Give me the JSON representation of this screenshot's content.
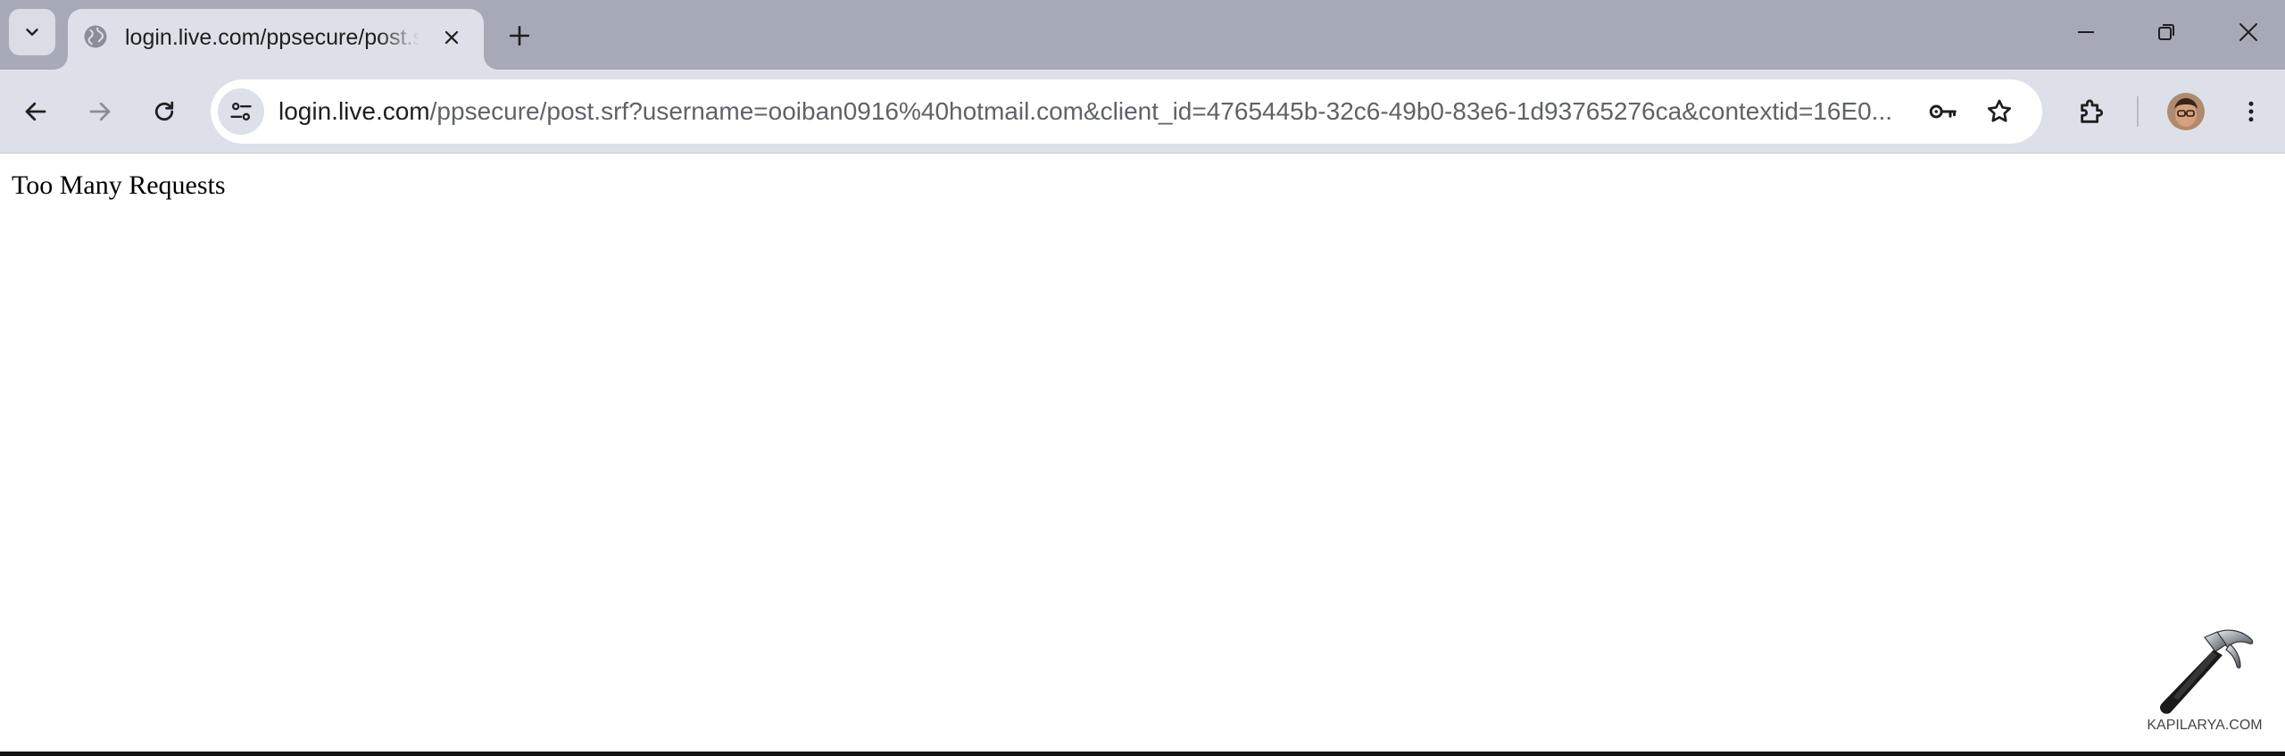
{
  "tab": {
    "title": "login.live.com/ppsecure/post.srf",
    "favicon": "globe-icon"
  },
  "window_controls": [
    "minimize",
    "restore",
    "close"
  ],
  "toolbar": {
    "url_host": "login.live.com",
    "url_path": "/ppsecure/post.srf?username=ooiban0916%40hotmail.com&client_id=4765445b-32c6-49b0-83e6-1d93765276ca&contextid=16E0..."
  },
  "page": {
    "message": "Too Many Requests"
  },
  "watermark": {
    "text": "KAPILARYA.COM"
  },
  "colors": {
    "tabstrip": "#a6aab6",
    "toolbar": "#dde0e8",
    "icon": "#1f1f1f"
  }
}
